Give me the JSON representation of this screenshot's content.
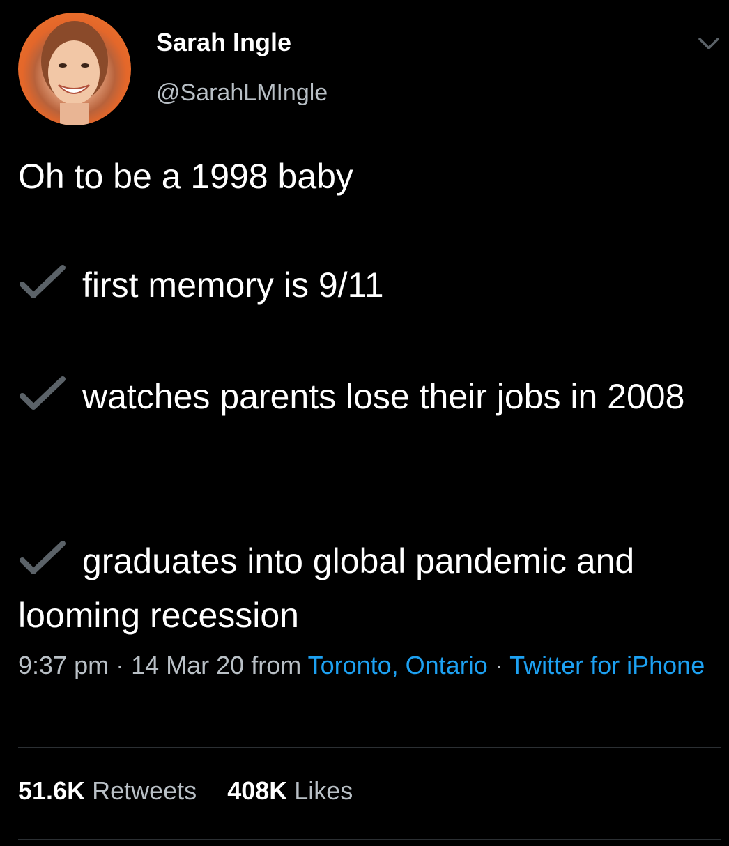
{
  "author": {
    "display_name": "Sarah Ingle",
    "handle": "@SarahLMIngle",
    "avatar": "profile-photo"
  },
  "menu_icon": "chevron-down-icon",
  "tweet": {
    "intro": "Oh to be a 1998 baby",
    "check_icon": "check-mark",
    "items": [
      {
        "text": "first memory is 9/11"
      },
      {
        "text": "watches parents lose their jobs in 2008"
      },
      {
        "text": "graduates into global pandemic and looming recession"
      }
    ]
  },
  "meta": {
    "time": "9:37 pm",
    "separator": "·",
    "date": "14 Mar 20",
    "from_label": "from",
    "location": "Toronto, Ontario",
    "client": "Twitter for iPhone"
  },
  "stats": {
    "retweets_count": "51.6K",
    "retweets_label": "Retweets",
    "likes_count": "408K",
    "likes_label": "Likes"
  },
  "colors": {
    "background": "#000000",
    "link": "#1da1f2",
    "secondary_text": "#b9c0c6",
    "check": "#5b6268"
  }
}
